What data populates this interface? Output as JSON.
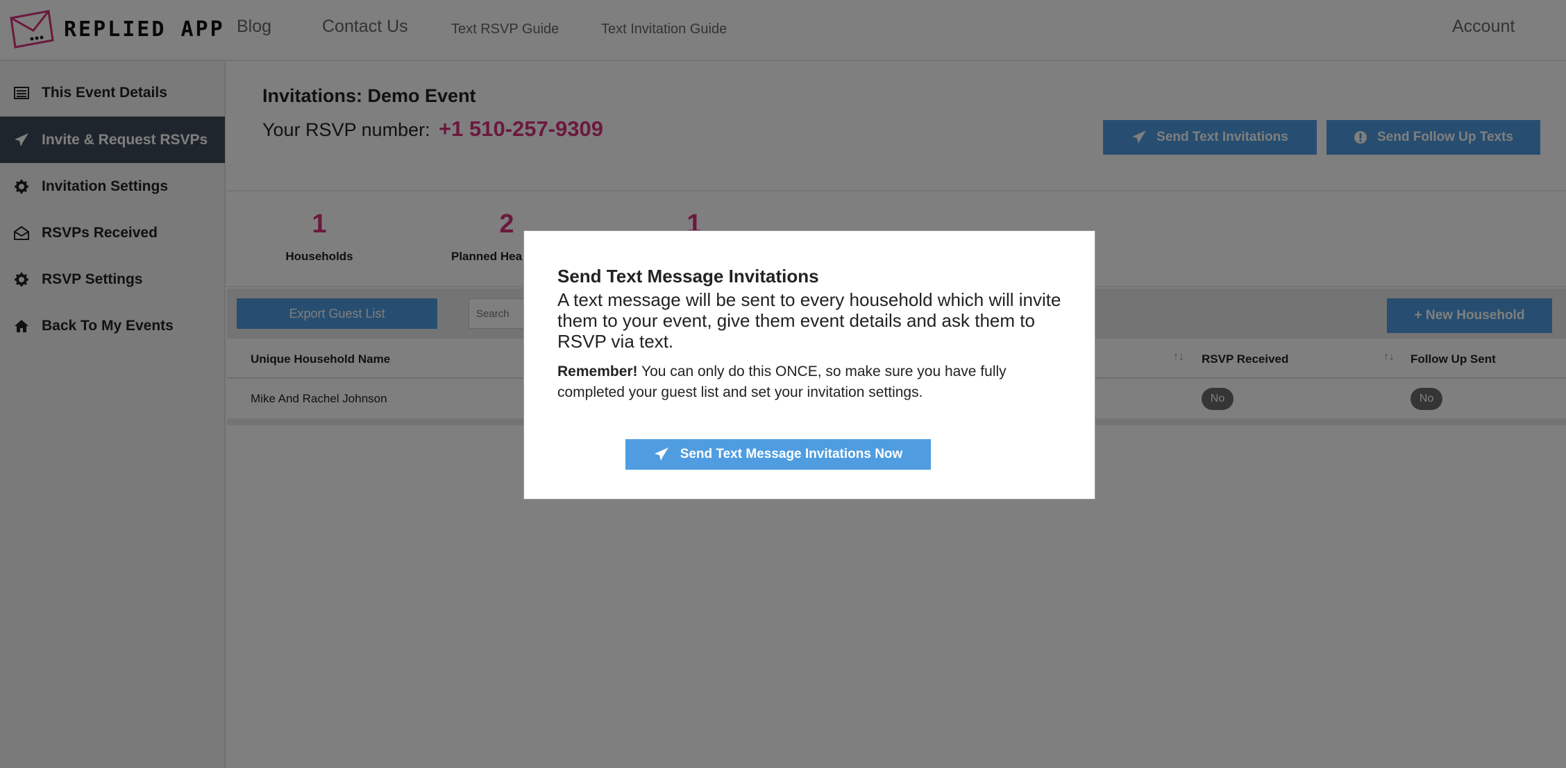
{
  "app": {
    "logo_text": "REPLIED APP"
  },
  "nav": {
    "blog": "Blog",
    "contact": "Contact Us",
    "rsvp_guide": "Text RSVP Guide",
    "invitation_guide": "Text Invitation Guide",
    "account": "Account"
  },
  "sidebar": {
    "items": [
      {
        "label": "This Event Details",
        "icon": "list-icon"
      },
      {
        "label": "Invite & Request RSVPs",
        "icon": "paper-plane-icon",
        "active": true
      },
      {
        "label": "Invitation Settings",
        "icon": "gear-icon"
      },
      {
        "label": "RSVPs Received",
        "icon": "envelope-open-icon"
      },
      {
        "label": "RSVP Settings",
        "icon": "gear-icon"
      },
      {
        "label": "Back To My Events",
        "icon": "home-icon"
      }
    ]
  },
  "header": {
    "title": "Invitations: Demo Event",
    "rsvp_label": "Your RSVP number:",
    "rsvp_number": "+1 510-257-9309",
    "send_invitations": "Send Text Invitations",
    "send_followups": "Send Follow Up Texts"
  },
  "stats": [
    {
      "value": "1",
      "label": "Households"
    },
    {
      "value": "2",
      "label": "Planned Hea"
    },
    {
      "value": "1",
      "label": ""
    }
  ],
  "toolbar": {
    "export": "Export Guest List",
    "search_placeholder": "Search",
    "new_household": "+ New Household"
  },
  "table": {
    "columns": [
      "Unique Household Name",
      "RSVP Received",
      "Follow Up Sent"
    ],
    "rows": [
      {
        "name": "Mike And Rachel Johnson",
        "rsvp_received": "No",
        "follow_up_sent": "No"
      }
    ]
  },
  "modal": {
    "title": "Send Text Message Invitations",
    "description": "A text message will be sent to every household which will invite them to your event, give them event details and ask them to RSVP via text.",
    "note_bold": "Remember!",
    "note_text": " You can only do this ONCE, so make sure you have fully completed your guest list and set your invitation settings.",
    "button": "Send Text Message Invitations Now"
  },
  "colors": {
    "accent": "#d6337a",
    "primary": "#4f9de0",
    "sidebar_active": "#3f4a58"
  }
}
